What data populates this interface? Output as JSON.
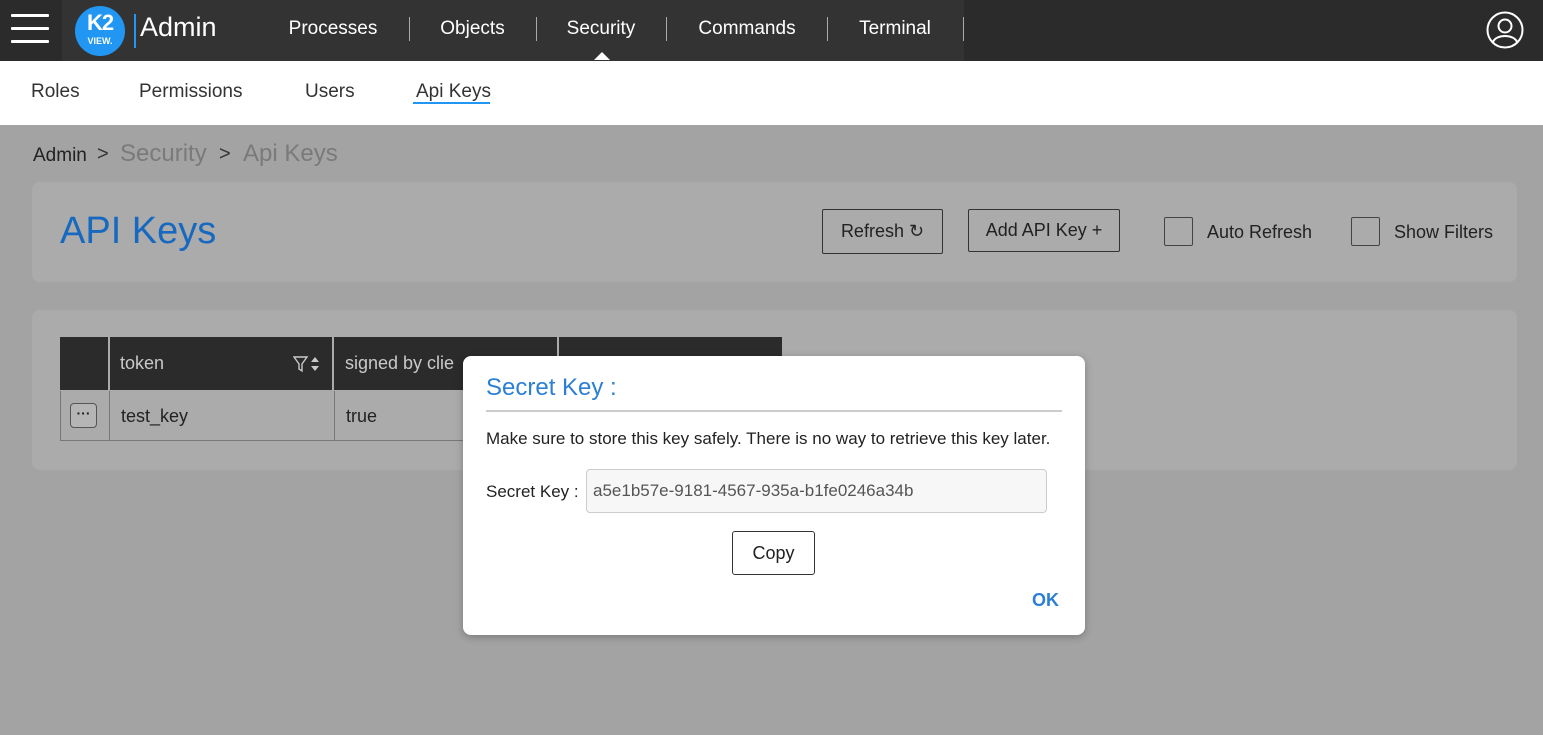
{
  "app": {
    "logo_text": "K2",
    "logo_subtext": "VIEW.",
    "title": "Admin"
  },
  "nav": {
    "items": [
      {
        "label": "Processes"
      },
      {
        "label": "Objects"
      },
      {
        "label": "Security"
      },
      {
        "label": "Commands"
      },
      {
        "label": "Terminal"
      }
    ],
    "active": "Security"
  },
  "subnav": {
    "items": [
      {
        "label": "Roles"
      },
      {
        "label": "Permissions"
      },
      {
        "label": "Users"
      },
      {
        "label": "Api Keys"
      }
    ],
    "active": "Api Keys"
  },
  "breadcrumb": {
    "items": [
      "Admin",
      "Security",
      "Api Keys"
    ],
    "separator": ">"
  },
  "header": {
    "title": "API Keys",
    "refresh_label": "Refresh ↻",
    "add_label": "Add API Key +",
    "auto_refresh_label": "Auto Refresh",
    "show_filters_label": "Show Filters"
  },
  "table": {
    "columns": [
      "token",
      "signed by clie"
    ],
    "rows": [
      {
        "actions": "···",
        "token": "test_key",
        "signed": "true"
      }
    ]
  },
  "modal": {
    "title": "Secret Key :",
    "message": "Make sure to store this key safely. There is no way to retrieve this key later.",
    "field_label": "Secret Key :",
    "field_value": "a5e1b57e-9181-4567-935a-b1fe0246a34b",
    "copy_label": "Copy",
    "ok_label": "OK"
  },
  "colors": {
    "accent": "#2196f3",
    "title_blue": "#1769c0",
    "topbar": "#2b2b2b",
    "overlay": "#a3a3a3"
  }
}
